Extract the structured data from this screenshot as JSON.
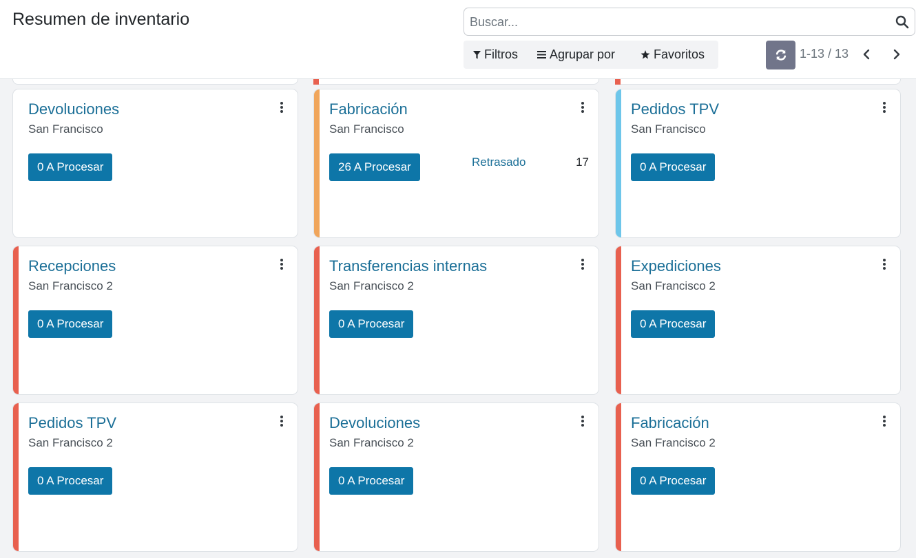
{
  "header": {
    "title": "Resumen de inventario",
    "search_placeholder": "Buscar...",
    "filters_label": "Filtros",
    "group_by_label": "Agrupar por",
    "favorites_label": "Favoritos",
    "pager_value": "1-13 / 13"
  },
  "colors": {
    "accent": "#0e76a8",
    "link": "#1b6f97",
    "stripe_orange": "#f0a55b",
    "stripe_blue": "#6ec6ea",
    "stripe_red": "#e8604f",
    "refresh_button": "#71758a"
  },
  "cards": [
    {
      "title": "Devoluciones",
      "subtitle": "San Francisco",
      "button_label": "0 A Procesar",
      "stripe": "none"
    },
    {
      "title": "Fabricación",
      "subtitle": "San Francisco",
      "button_label": "26 A Procesar",
      "stripe": "orange",
      "late_label": "Retrasado",
      "late_count": "17"
    },
    {
      "title": "Pedidos TPV",
      "subtitle": "San Francisco",
      "button_label": "0 A Procesar",
      "stripe": "blue"
    },
    {
      "title": "Recepciones",
      "subtitle": "San Francisco 2",
      "button_label": "0 A Procesar",
      "stripe": "red"
    },
    {
      "title": "Transferencias internas",
      "subtitle": "San Francisco 2",
      "button_label": "0 A Procesar",
      "stripe": "red"
    },
    {
      "title": "Expediciones",
      "subtitle": "San Francisco 2",
      "button_label": "0 A Procesar",
      "stripe": "red"
    },
    {
      "title": "Pedidos TPV",
      "subtitle": "San Francisco 2",
      "button_label": "0 A Procesar",
      "stripe": "red"
    },
    {
      "title": "Devoluciones",
      "subtitle": "San Francisco 2",
      "button_label": "0 A Procesar",
      "stripe": "red"
    },
    {
      "title": "Fabricación",
      "subtitle": "San Francisco 2",
      "button_label": "0 A Procesar",
      "stripe": "red"
    }
  ]
}
